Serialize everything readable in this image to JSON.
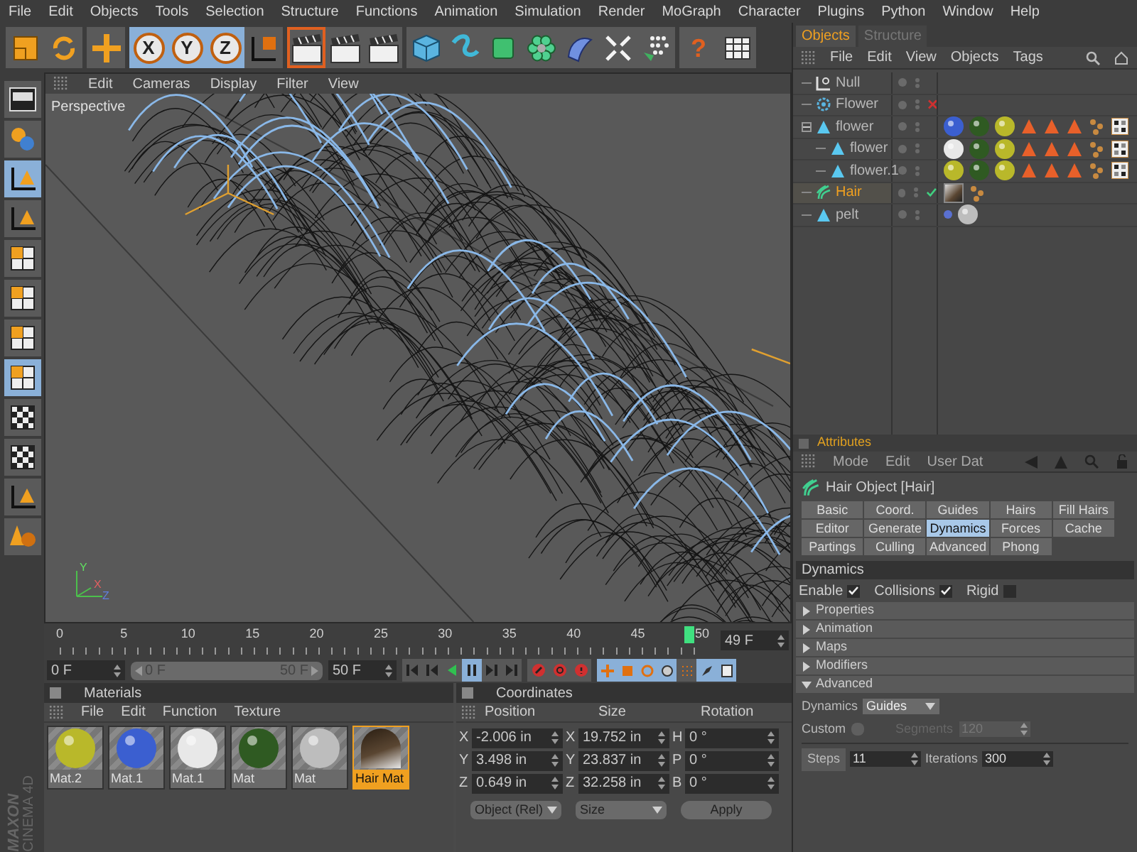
{
  "menu": [
    "File",
    "Edit",
    "Objects",
    "Tools",
    "Selection",
    "Structure",
    "Functions",
    "Animation",
    "Simulation",
    "Render",
    "MoGraph",
    "Character",
    "Plugins",
    "Python",
    "Window",
    "Help"
  ],
  "toolbar": [
    [
      {
        "kind": "frame",
        "selected": false
      },
      {
        "kind": "cycle",
        "selected": false
      }
    ],
    [
      {
        "kind": "move",
        "selected": false
      }
    ],
    [
      {
        "kind": "axis",
        "label": "X",
        "selected": true
      },
      {
        "kind": "axis",
        "label": "Y",
        "selected": true
      },
      {
        "kind": "axis",
        "label": "Z",
        "selected": true
      },
      {
        "kind": "coords",
        "selected": false
      }
    ],
    [
      {
        "kind": "clapper",
        "selected": true
      },
      {
        "kind": "clapper",
        "selected": false
      },
      {
        "kind": "clapper",
        "selected": false
      }
    ],
    [
      {
        "kind": "cube",
        "selected": false
      },
      {
        "kind": "spline",
        "selected": false
      },
      {
        "kind": "nurbs",
        "selected": false
      },
      {
        "kind": "cloner",
        "selected": false
      },
      {
        "kind": "deformer",
        "selected": false
      },
      {
        "kind": "scene",
        "selected": false
      },
      {
        "kind": "particles",
        "selected": false
      }
    ],
    [
      {
        "kind": "help",
        "label": "?",
        "selected": false
      },
      {
        "kind": "table",
        "selected": false
      }
    ]
  ],
  "side_tools": [
    {
      "kind": "layout",
      "selected": false
    },
    {
      "kind": "spheres",
      "selected": false
    },
    {
      "kind": "axis",
      "selected": true
    },
    {
      "kind": "axis",
      "selected": false
    },
    {
      "kind": "grid",
      "selected": false
    },
    {
      "kind": "grid",
      "selected": false
    },
    {
      "kind": "grid",
      "selected": false
    },
    {
      "kind": "grid",
      "selected": true
    },
    {
      "kind": "checker",
      "selected": false
    },
    {
      "kind": "checker",
      "selected": false
    },
    {
      "kind": "axis",
      "selected": false
    },
    {
      "kind": "cone",
      "selected": false
    }
  ],
  "logo": {
    "brand": "MAXON",
    "product": "CINEMA 4D"
  },
  "viewport": {
    "menu": [
      "Edit",
      "Cameras",
      "Display",
      "Filter",
      "View"
    ],
    "label": "Perspective",
    "axis_labels": [
      "Y",
      "X",
      "Z"
    ]
  },
  "timeline": {
    "ticks": [
      "0",
      "5",
      "10",
      "15",
      "20",
      "25",
      "30",
      "35",
      "40",
      "45",
      "50"
    ],
    "level": 0.98,
    "current": "49 F"
  },
  "transport": {
    "start": "0 F",
    "range_start": "0 F",
    "range_end": "50 F",
    "range": {
      "level": 1
    },
    "end": "50 F",
    "buttons": [
      {
        "kind": "first",
        "selected": false
      },
      {
        "kind": "prev",
        "selected": false
      },
      {
        "kind": "play-back",
        "selected": false
      },
      {
        "kind": "pause",
        "selected": true
      },
      {
        "kind": "next",
        "selected": false
      },
      {
        "kind": "last",
        "selected": false
      }
    ],
    "record": [
      {
        "kind": "record"
      },
      {
        "kind": "auto"
      },
      {
        "kind": "keys"
      }
    ],
    "keys": [
      {
        "kind": "move",
        "on": true
      },
      {
        "kind": "scale",
        "on": true
      },
      {
        "kind": "rotate",
        "on": true
      },
      {
        "kind": "param",
        "on": true
      },
      {
        "kind": "points",
        "on": false
      },
      {
        "kind": "selection",
        "on": true
      },
      {
        "kind": "sheet",
        "on": true
      }
    ]
  },
  "materials": {
    "title": "Materials",
    "menu": [
      "File",
      "Edit",
      "Function",
      "Texture"
    ],
    "items": [
      {
        "name": "Mat.2",
        "kind": "sphere",
        "color": "#b9b82a",
        "selected": false
      },
      {
        "name": "Mat.1",
        "kind": "sphere",
        "color": "#3b5fd0",
        "selected": false
      },
      {
        "name": "Mat.1",
        "kind": "sphere",
        "color": "#e8e8e8",
        "selected": false
      },
      {
        "name": "Mat",
        "kind": "sphere",
        "color": "#2f5a22",
        "selected": false
      },
      {
        "name": "Mat",
        "kind": "sphere",
        "color": "#bdbdbd",
        "selected": false
      },
      {
        "name": "Hair Mat",
        "kind": "hair",
        "color": "#5a4632",
        "selected": true
      }
    ]
  },
  "coordinates": {
    "title": "Coordinates",
    "columns": [
      "Position",
      "Size",
      "Rotation"
    ],
    "rows": [
      {
        "axis": "X",
        "position": "-2.006 in",
        "size_axis": "X",
        "size": "19.752 in",
        "rot_axis": "H",
        "rotation": "0 °"
      },
      {
        "axis": "Y",
        "position": "3.498 in",
        "size_axis": "Y",
        "size": "23.837 in",
        "rot_axis": "P",
        "rotation": "0 °"
      },
      {
        "axis": "Z",
        "position": "0.649 in",
        "size_axis": "Z",
        "size": "32.258 in",
        "rot_axis": "B",
        "rotation": "0 °"
      }
    ],
    "mode": "Object (Rel)",
    "size_mode": "Size",
    "apply": "Apply"
  },
  "objects": {
    "tabs": [
      {
        "label": "Objects",
        "selected": true
      },
      {
        "label": "Structure",
        "selected": false
      }
    ],
    "menu": [
      "File",
      "Edit",
      "View",
      "Objects",
      "Tags"
    ],
    "tree": [
      {
        "name": "Null",
        "kind": "null",
        "selected": false
      },
      {
        "name": "Flower",
        "kind": "flower",
        "selected": false,
        "enabled": false
      },
      {
        "name": "flower",
        "kind": "polygon",
        "selected": false,
        "expanded": true,
        "tags": [
          {
            "kind": "material",
            "color": "#3b5fd0"
          },
          {
            "kind": "material",
            "color": "#2f5a22"
          },
          {
            "kind": "material",
            "color": "#b9b82a"
          },
          {
            "kind": "phong"
          },
          {
            "kind": "phong"
          },
          {
            "kind": "phong"
          },
          {
            "kind": "uv"
          },
          {
            "kind": "texture"
          }
        ],
        "children": [
          {
            "name": "flower",
            "kind": "polygon",
            "selected": false,
            "tags": [
              {
                "kind": "material",
                "color": "#e8e8e8"
              },
              {
                "kind": "material",
                "color": "#2f5a22"
              },
              {
                "kind": "material",
                "color": "#b9b82a"
              },
              {
                "kind": "phong"
              },
              {
                "kind": "phong"
              },
              {
                "kind": "phong"
              },
              {
                "kind": "uv"
              },
              {
                "kind": "texture"
              }
            ]
          },
          {
            "name": "flower.1",
            "kind": "polygon",
            "selected": false,
            "tags": [
              {
                "kind": "material",
                "color": "#b9b82a"
              },
              {
                "kind": "material",
                "color": "#2f5a22"
              },
              {
                "kind": "material",
                "color": "#b9b82a"
              },
              {
                "kind": "phong"
              },
              {
                "kind": "phong"
              },
              {
                "kind": "phong"
              },
              {
                "kind": "uv"
              },
              {
                "kind": "texture"
              }
            ]
          }
        ]
      },
      {
        "name": "Hair",
        "kind": "hair",
        "selected": true,
        "enabled": true,
        "tags": [
          {
            "kind": "hair-material"
          },
          {
            "kind": "uv"
          }
        ]
      },
      {
        "name": "pelt",
        "kind": "polygon",
        "selected": false,
        "tags": [
          {
            "kind": "dot"
          },
          {
            "kind": "material",
            "color": "#bdbdbd"
          }
        ]
      }
    ]
  },
  "attributes": {
    "title": "Attributes",
    "menu": [
      "Mode",
      "Edit",
      "User Dat"
    ],
    "object": "Hair Object [Hair]",
    "tabs": [
      {
        "label": "Basic",
        "selected": false
      },
      {
        "label": "Coord.",
        "selected": false
      },
      {
        "label": "Guides",
        "selected": false
      },
      {
        "label": "Hairs",
        "selected": false
      },
      {
        "label": "Fill Hairs",
        "selected": false
      },
      {
        "label": "Editor",
        "selected": false
      },
      {
        "label": "Generate",
        "selected": false
      },
      {
        "label": "Dynamics",
        "selected": true
      },
      {
        "label": "Forces",
        "selected": false
      },
      {
        "label": "Cache",
        "selected": false
      },
      {
        "label": "Partings",
        "selected": false
      },
      {
        "label": "Culling",
        "selected": false
      },
      {
        "label": "Advanced",
        "selected": false
      },
      {
        "label": "Phong",
        "selected": false
      }
    ],
    "section": "Dynamics",
    "checks": [
      {
        "label": "Enable",
        "checked": true
      },
      {
        "label": "Collisions",
        "checked": true
      },
      {
        "label": "Rigid",
        "checked": false
      }
    ],
    "groups": [
      {
        "label": "Properties",
        "expanded": false
      },
      {
        "label": "Animation",
        "expanded": false
      },
      {
        "label": "Maps",
        "expanded": false
      },
      {
        "label": "Modifiers",
        "expanded": false
      },
      {
        "label": "Advanced",
        "expanded": true
      }
    ],
    "advanced": {
      "dynamics_label": "Dynamics",
      "dynamics_value": "Guides",
      "custom_label": "Custom",
      "custom_checked": false,
      "segments_label": "Segments",
      "segments_value": "120",
      "segments_disabled": true,
      "steps_label": "Steps",
      "steps_value": "11",
      "iterations_label": "Iterations",
      "iterations_value": "300"
    }
  }
}
